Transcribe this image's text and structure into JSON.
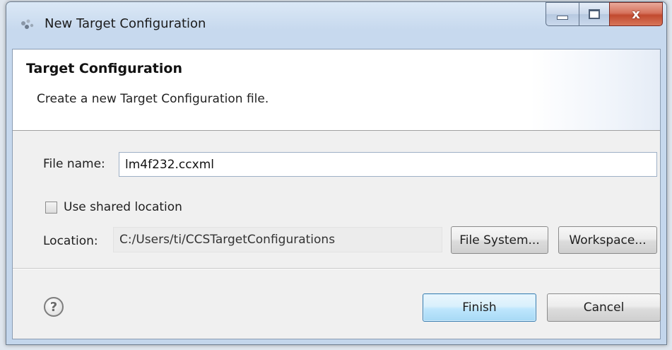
{
  "window": {
    "title": "New Target Configuration",
    "close_glyph": "x"
  },
  "banner": {
    "title": "Target Configuration",
    "description": "Create a new Target Configuration file."
  },
  "form": {
    "file_name_label": "File name:",
    "file_name_value": "lm4f232.ccxml",
    "shared_checkbox_label": "Use shared location",
    "shared_checked": false,
    "location_label": "Location:",
    "location_value": "C:/Users/ti/CCSTargetConfigurations",
    "file_system_button": "File System...",
    "workspace_button": "Workspace..."
  },
  "footer": {
    "help_glyph": "?",
    "finish_button": "Finish",
    "cancel_button": "Cancel"
  },
  "colors": {
    "titlebar": "#c7d9ee",
    "close_button": "#c14a2f",
    "default_button": "#bee6fd"
  },
  "icons": [
    "eclipse-app-icon",
    "minimize-icon",
    "maximize-icon",
    "close-icon",
    "help-icon",
    "checkbox-icon"
  ]
}
